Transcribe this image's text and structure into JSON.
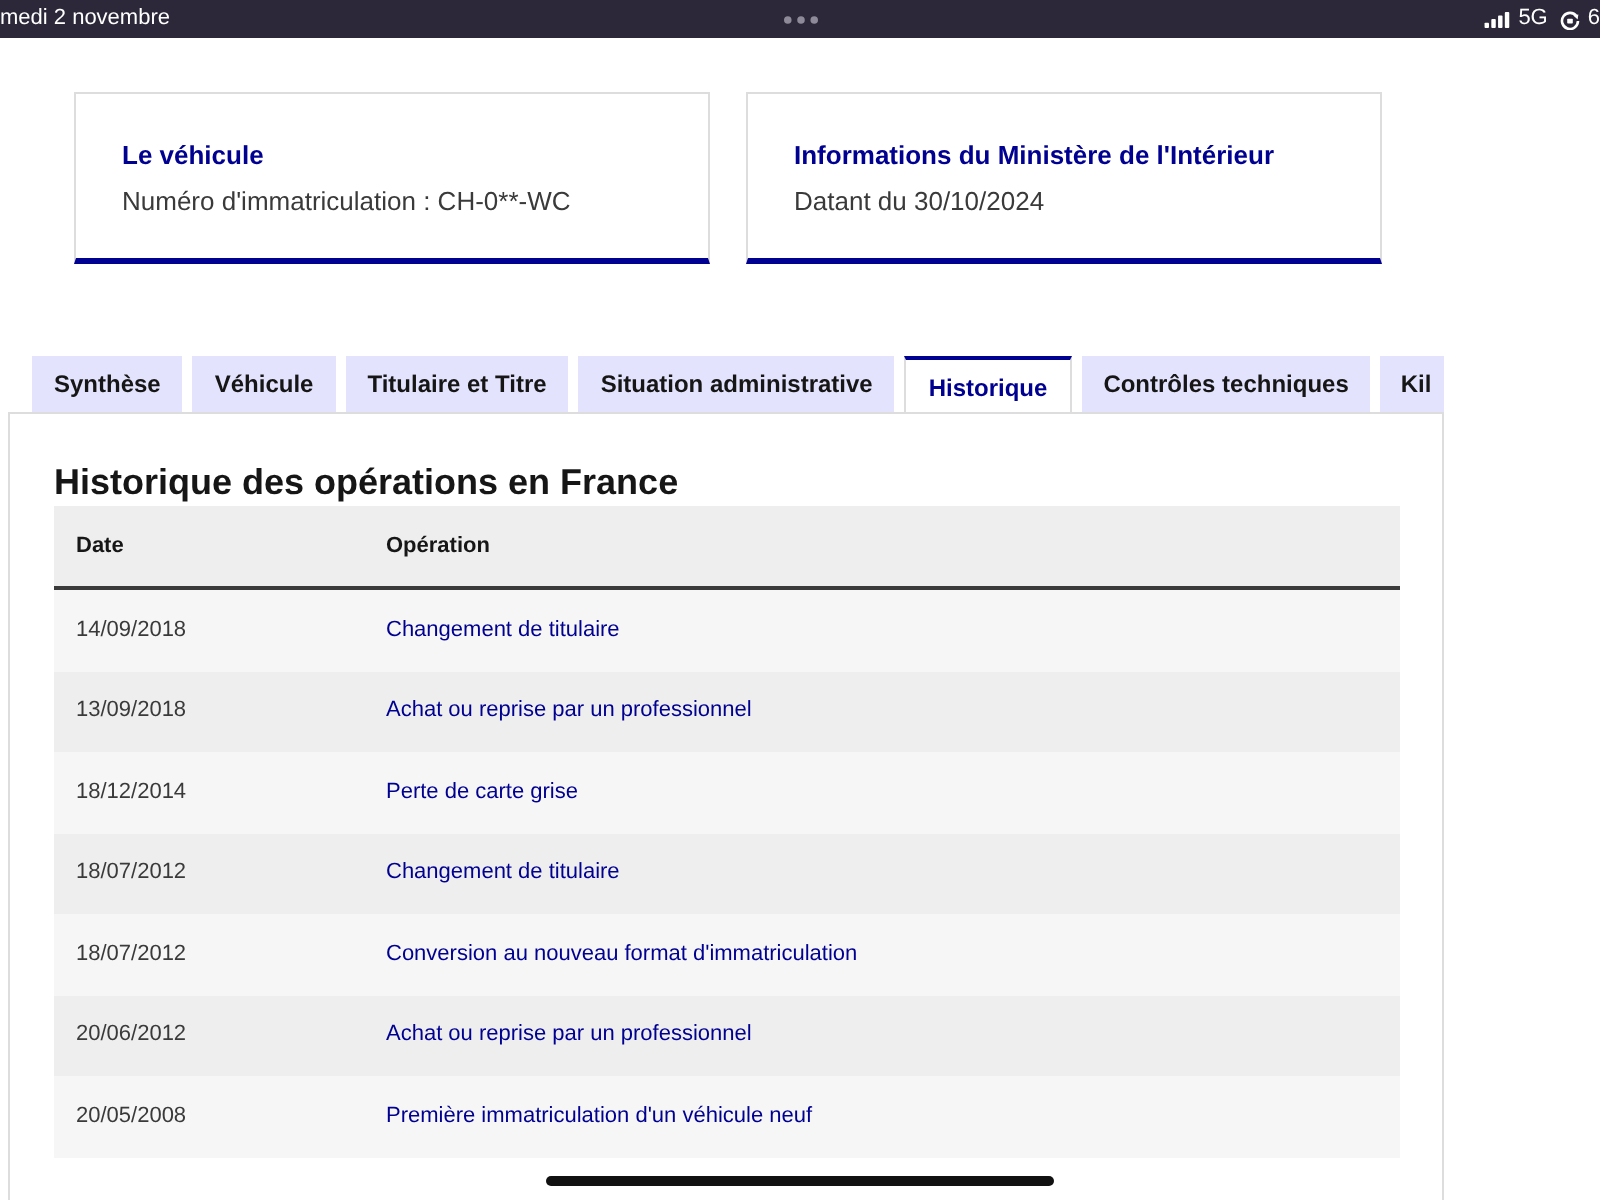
{
  "status_bar": {
    "date": "medi 2 novembre",
    "network": "5G",
    "battery": "6"
  },
  "cards": [
    {
      "title": "Le véhicule",
      "text": "Numéro d'immatriculation : CH-0**-WC"
    },
    {
      "title": "Informations du Ministère de l'Intérieur",
      "text": "Datant du 30/10/2024"
    }
  ],
  "tabs": [
    {
      "label": "Synthèse",
      "selected": false
    },
    {
      "label": "Véhicule",
      "selected": false
    },
    {
      "label": "Titulaire et Titre",
      "selected": false
    },
    {
      "label": "Situation administrative",
      "selected": false
    },
    {
      "label": "Historique",
      "selected": true
    },
    {
      "label": "Contrôles techniques",
      "selected": false
    },
    {
      "label": "Kil",
      "selected": false
    }
  ],
  "history": {
    "title": "Historique des opérations en France",
    "columns": [
      "Date",
      "Opération"
    ],
    "rows": [
      {
        "date": "14/09/2018",
        "operation": "Changement de titulaire"
      },
      {
        "date": "13/09/2018",
        "operation": "Achat ou reprise par un professionnel"
      },
      {
        "date": "18/12/2014",
        "operation": "Perte de carte grise"
      },
      {
        "date": "18/07/2012",
        "operation": "Changement de titulaire"
      },
      {
        "date": "18/07/2012",
        "operation": "Conversion au nouveau format d'immatriculation"
      },
      {
        "date": "20/06/2012",
        "operation": "Achat ou reprise par un professionnel"
      },
      {
        "date": "20/05/2008",
        "operation": "Première immatriculation d'un véhicule neuf"
      }
    ]
  }
}
